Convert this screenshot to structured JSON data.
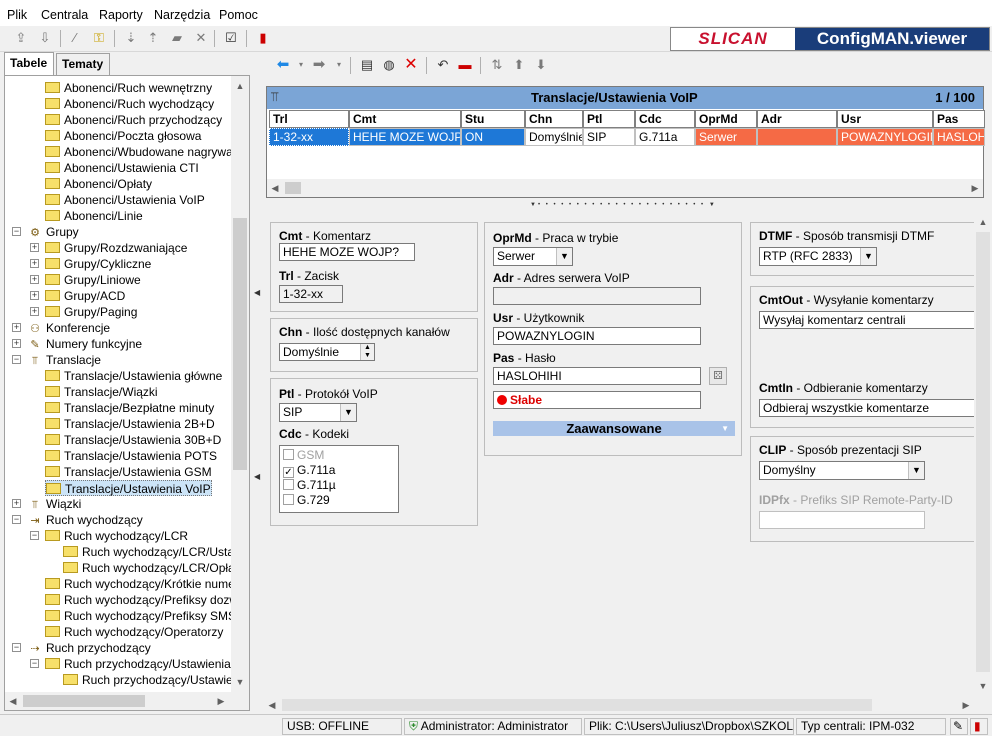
{
  "menu": [
    "Plik",
    "Centrala",
    "Raporty",
    "Narzędzia",
    "Pomoc"
  ],
  "logo": {
    "left": "SLICAN",
    "right": "ConfigMAN.viewer"
  },
  "left_tabs": [
    "Tabele",
    "Tematy"
  ],
  "tree": [
    "Abonenci/Ruch wewnętrzny",
    "Abonenci/Ruch wychodzący",
    "Abonenci/Ruch przychodzący",
    "Abonenci/Poczta głosowa",
    "Abonenci/Wbudowane nagrywani",
    "Abonenci/Ustawienia CTI",
    "Abonenci/Opłaty",
    "Abonenci/Ustawienia VoIP",
    "Abonenci/Linie",
    "Grupy",
    "Grupy/Rozdzwaniające",
    "Grupy/Cykliczne",
    "Grupy/Liniowe",
    "Grupy/ACD",
    "Grupy/Paging",
    "Konferencje",
    "Numery funkcyjne",
    "Translacje",
    "Translacje/Ustawienia główne",
    "Translacje/Wiązki",
    "Translacje/Bezpłatne minuty",
    "Translacje/Ustawienia 2B+D",
    "Translacje/Ustawienia 30B+D",
    "Translacje/Ustawienia POTS",
    "Translacje/Ustawienia GSM",
    "Translacje/Ustawienia VoIP",
    "Wiązki",
    "Ruch wychodzący",
    "Ruch wychodzący/LCR",
    "Ruch wychodzący/LCR/Ustav",
    "Ruch wychodzący/LCR/Opłat",
    "Ruch wychodzący/Krótkie numery",
    "Ruch wychodzący/Prefiksy dozwo",
    "Ruch wychodzący/Prefiksy SMS",
    "Ruch wychodzący/Operatorzy",
    "Ruch przychodzący",
    "Ruch przychodzący/Ustawienia",
    "Ruch przychodzący/Ustawien"
  ],
  "grid": {
    "title": "Translacje/Ustawienia VoIP",
    "counter": "1 / 100",
    "columns": [
      "Trl",
      "Cmt",
      "Stu",
      "Chn",
      "Ptl",
      "Cdc",
      "OprMd",
      "Adr",
      "Usr",
      "Pas"
    ],
    "row": [
      "1-32-xx",
      "HEHE MOZE WOJP?",
      "ON",
      "Domyślnie",
      "SIP",
      "G.711a",
      "Serwer",
      "",
      "POWAZNYLOGIN",
      "HASLOHI"
    ]
  },
  "form": {
    "cmt_code": "Cmt",
    "cmt_label": " - Komentarz",
    "cmt_value": "HEHE MOZE WOJP?",
    "trl_code": "Trl",
    "trl_label": " - Zacisk",
    "trl_value": "1-32-xx",
    "chn_code": "Chn",
    "chn_label": " - Ilość dostępnych kanałów",
    "chn_value": "Domyślnie",
    "ptl_code": "Ptl",
    "ptl_label": " - Protokół VoIP",
    "ptl_value": "SIP",
    "cdc_code": "Cdc",
    "cdc_label": " - Kodeki",
    "codecs": [
      {
        "name": "GSM",
        "checked": false,
        "enabled": false
      },
      {
        "name": "G.711a",
        "checked": true,
        "enabled": true
      },
      {
        "name": "G.711µ",
        "checked": false,
        "enabled": true
      },
      {
        "name": "G.729",
        "checked": false,
        "enabled": true
      }
    ],
    "oprmd_code": "OprMd",
    "oprmd_label": " - Praca w trybie",
    "oprmd_value": "Serwer",
    "adr_code": "Adr",
    "adr_label": " - Adres serwera VoIP",
    "adr_value": "",
    "usr_code": "Usr",
    "usr_label": " - Użytkownik",
    "usr_value": "POWAZNYLOGIN",
    "pas_code": "Pas",
    "pas_label": " - Hasło",
    "pas_value": "HASLOHIHI",
    "strength": "Słabe",
    "advanced": "Zaawansowane",
    "dtmf_code": "DTMF",
    "dtmf_label": " - Sposób transmisji DTMF",
    "dtmf_value": "RTP (RFC 2833)",
    "cmtout_code": "CmtOut",
    "cmtout_label": " - Wysyłanie komentarzy",
    "cmtout_value": "Wysyłaj komentarz centrali",
    "cmtin_code": "CmtIn",
    "cmtin_label": " - Odbieranie komentarzy",
    "cmtin_value": "Odbieraj wszystkie komentarze",
    "clip_code": "CLIP",
    "clip_label": " - Sposób prezentacji SIP",
    "clip_value": "Domyślny",
    "idpfx_code": "IDPfx",
    "idpfx_label": " - Prefiks SIP Remote-Party-ID",
    "idpfx_value": ""
  },
  "status": {
    "usb": "USB: OFFLINE",
    "user": "Administrator: Administrator",
    "file": "Plik: C:\\Users\\Juliusz\\Dropbox\\SZKOLA",
    "type": "Typ centrali: IPM-032"
  },
  "colors": {
    "header": "#7ba5d6",
    "selected": "#1e78d7",
    "highlight": "#f56a45",
    "brand_red": "#c8102e",
    "brand_blue": "#1a3d7a"
  }
}
